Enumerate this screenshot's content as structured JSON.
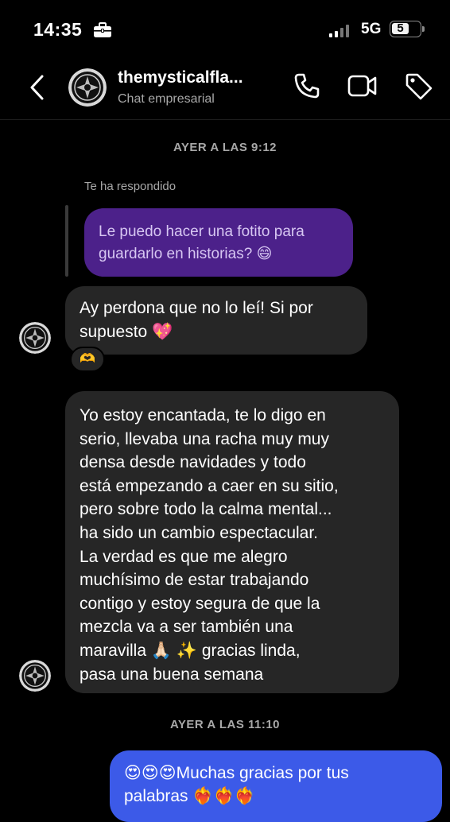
{
  "status_bar": {
    "time": "14:35",
    "network": "5G",
    "battery": "5"
  },
  "header": {
    "name": "themysticalfla...",
    "subtitle": "Chat empresarial"
  },
  "messages": {
    "timestamp_1": "AYER A LAS 9:12",
    "reply_label": "Te ha respondido",
    "quoted_line_1": "Le puedo hacer una fotito para",
    "quoted_line_2": "guardarlo en historias? 😄",
    "msg1_line_1": "Ay perdona que no lo leí! Si por",
    "msg1_line_2": "supuesto 💖",
    "reaction": "🫶",
    "msg2_lines": [
      "Yo estoy encantada, te lo digo en",
      "serio, llevaba una racha muy muy",
      "densa desde navidades y todo",
      "está empezando a caer en su sitio,",
      "pero sobre todo la calma mental...",
      "ha sido un cambio espectacular.",
      "La verdad es que me alegro",
      "muchísimo de estar trabajando",
      "contigo y estoy segura de que la",
      "mezcla va a ser también una",
      "maravilla 🙏🏻 ✨ gracias linda,",
      "pasa una buena semana"
    ],
    "timestamp_2": "AYER A LAS 11:10",
    "out_line_1": "😍😍😍Muchas gracias por tus",
    "out_line_2": "palabras ❤️‍🔥❤️‍🔥❤️‍🔥"
  },
  "colors": {
    "background": "#000000",
    "incoming_bubble": "#262626",
    "outgoing_bubble": "#3c5ae8",
    "quoted_bubble": "#4c218a",
    "muted_text": "#a8a8a8"
  },
  "icons": [
    "briefcase-icon",
    "back-chevron-icon",
    "phone-icon",
    "video-icon",
    "tag-icon"
  ]
}
